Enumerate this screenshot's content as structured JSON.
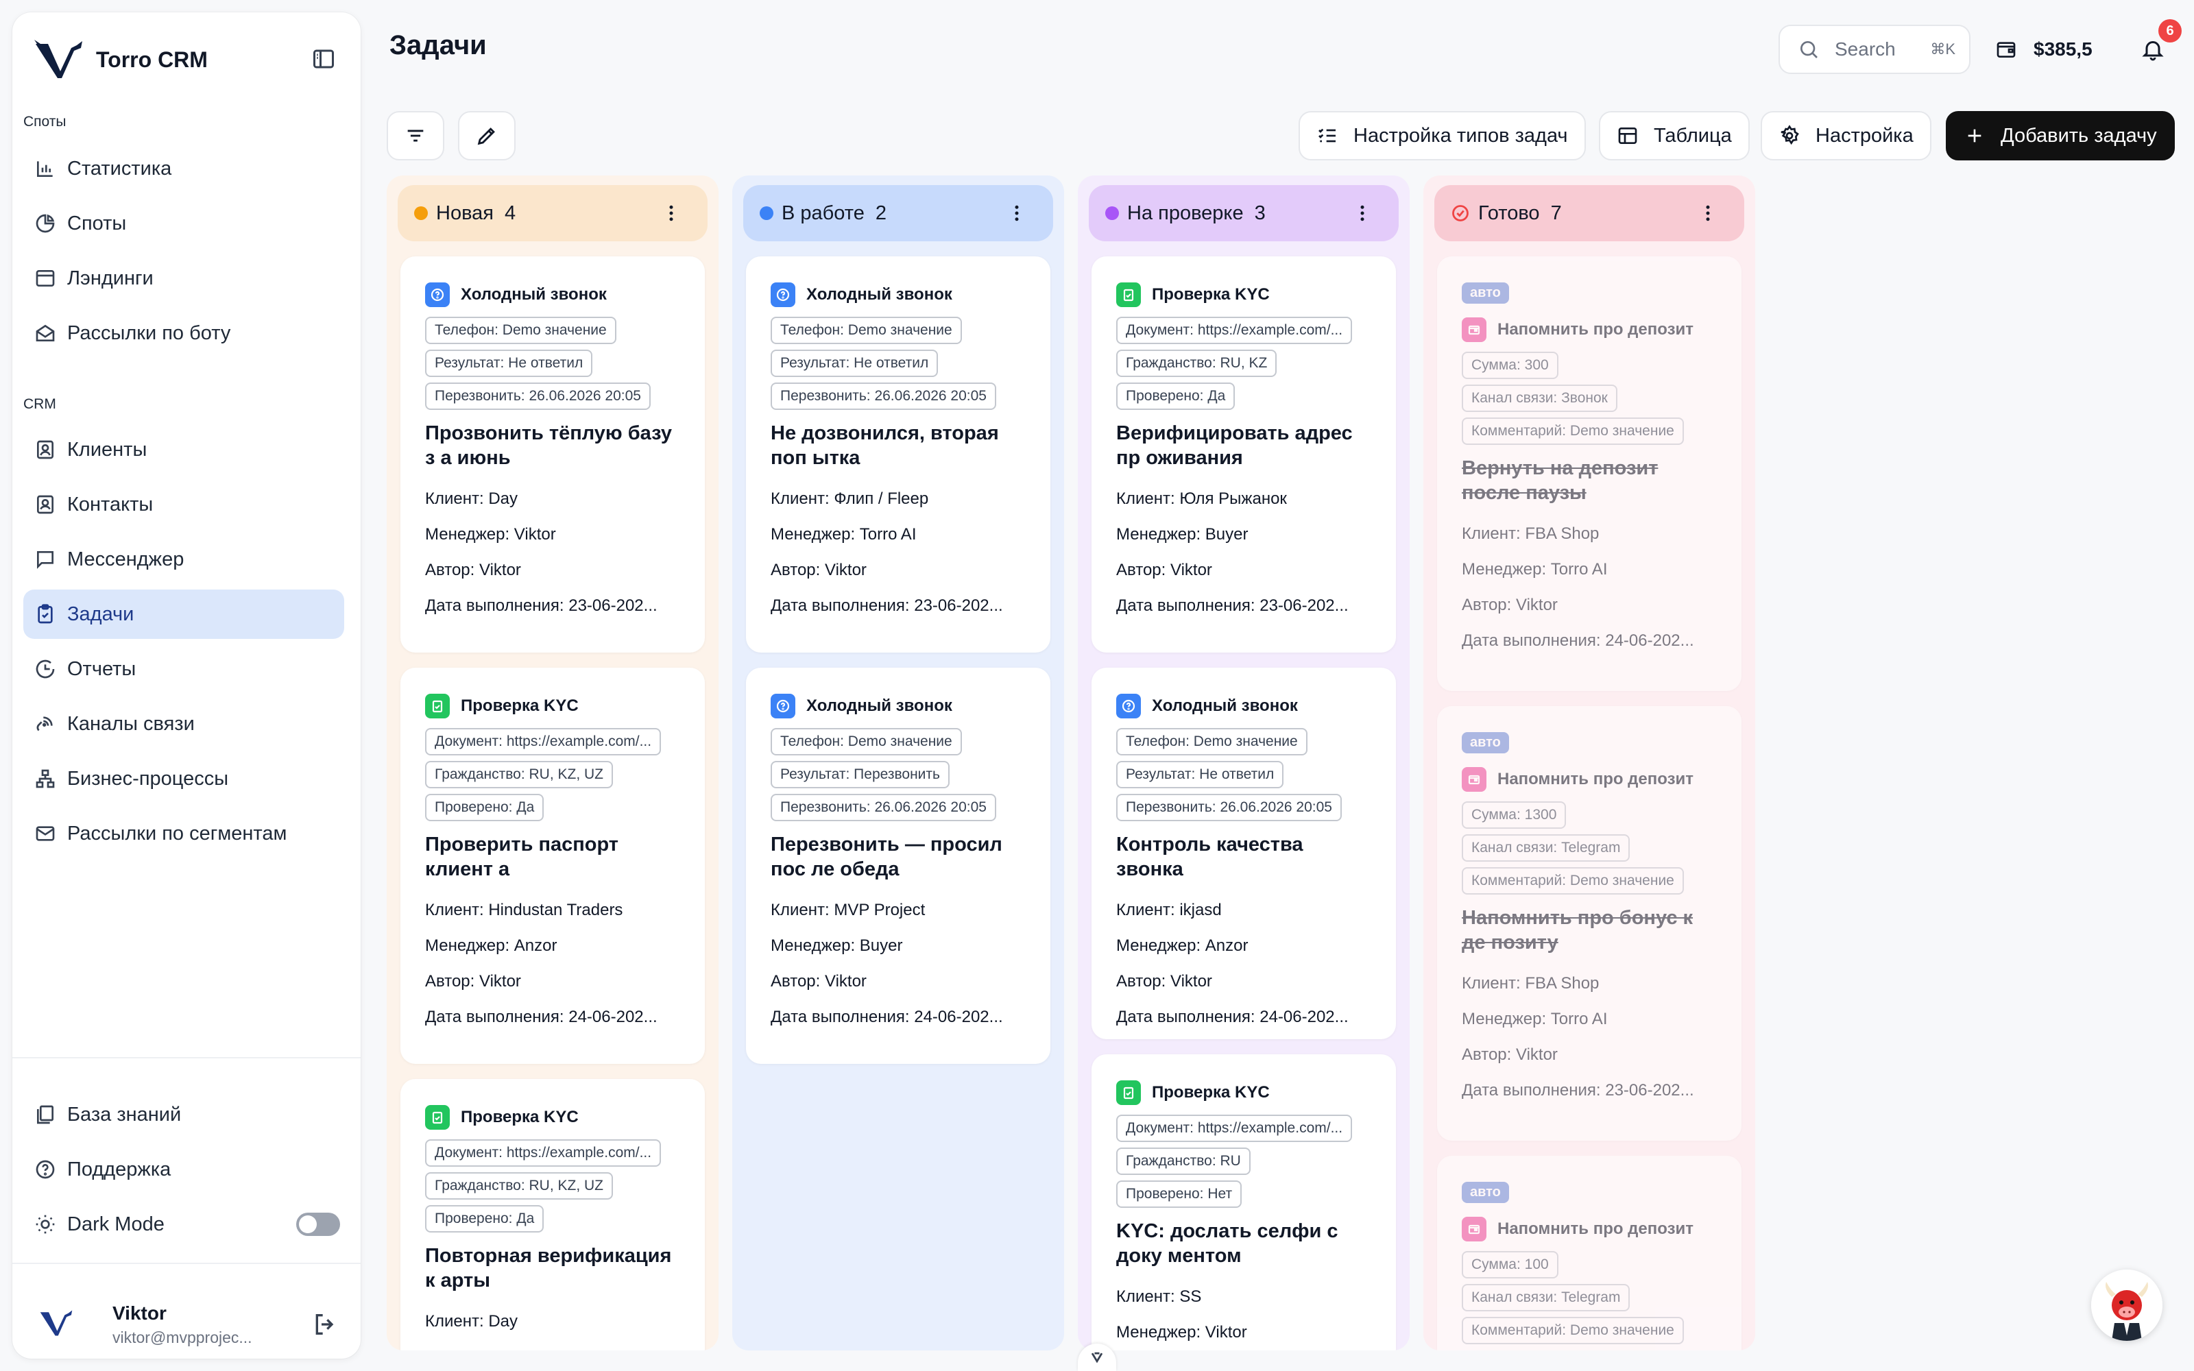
{
  "app": {
    "name": "Torro CRM"
  },
  "sidebar": {
    "section_spots": "Споты",
    "section_crm": "CRM",
    "items_spots": [
      {
        "label": "Статистика",
        "icon": "bar-chart-icon"
      },
      {
        "label": "Споты",
        "icon": "pie-chart-icon"
      },
      {
        "label": "Лэндинги",
        "icon": "window-icon"
      },
      {
        "label": "Рассылки по боту",
        "icon": "mail-open-icon"
      }
    ],
    "items_crm": [
      {
        "label": "Клиенты",
        "icon": "user-square-icon"
      },
      {
        "label": "Контакты",
        "icon": "contact-icon"
      },
      {
        "label": "Мессенджер",
        "icon": "message-icon"
      },
      {
        "label": "Задачи",
        "icon": "clipboard-check-icon",
        "active": true
      },
      {
        "label": "Отчеты",
        "icon": "clock-icon"
      },
      {
        "label": "Каналы связи",
        "icon": "link-icon"
      },
      {
        "label": "Бизнес-процессы",
        "icon": "network-icon"
      },
      {
        "label": "Рассылки по сегментам",
        "icon": "mail-icon"
      }
    ],
    "items_bottom": [
      {
        "label": "База знаний",
        "icon": "book-icon"
      },
      {
        "label": "Поддержка",
        "icon": "help-circle-icon"
      },
      {
        "label": "Dark Mode",
        "icon": "sun-icon"
      }
    ],
    "user": {
      "name": "Viktor",
      "email": "viktor@mvpprojec..."
    }
  },
  "header": {
    "title": "Задачи",
    "search_placeholder": "Search",
    "search_shortcut": "⌘K",
    "balance": "$385,5",
    "notifications": "6"
  },
  "toolbar": {
    "task_types": "Настройка типов задач",
    "table": "Таблица",
    "settings": "Настройка",
    "add_task": "Добавить задачу"
  },
  "colors": {
    "accent": "#111111",
    "col_new": "#fbe6cc",
    "col_work": "#c7dafc",
    "col_review": "#e3cbfa",
    "col_done": "#f8cbd3"
  },
  "columns": [
    {
      "title": "Новая",
      "count": "4",
      "cards": [
        {
          "type": "Холодный звонок",
          "tags": [
            "Телефон: Demo значение",
            "Результат: Не ответил",
            "Перезвонить: 26.06.2026 20:05"
          ],
          "title": "Прозвонить тёплую базу з а июнь",
          "client": "Day",
          "manager": "Viktor",
          "author": "Viktor",
          "due": "23-06-202..."
        },
        {
          "type": "Проверка KYC",
          "tags": [
            "Документ: https://example.com/...",
            "Гражданство: RU, KZ, UZ",
            "Проверено: Да"
          ],
          "title": "Проверить паспорт клиент а",
          "client": "Hindustan Traders",
          "manager": "Anzor",
          "author": "Viktor",
          "due": "24-06-202..."
        },
        {
          "type": "Проверка KYC",
          "tags": [
            "Документ: https://example.com/...",
            "Гражданство: RU, KZ, UZ",
            "Проверено: Да"
          ],
          "title": "Повторная верификация к арты",
          "client": "Day",
          "manager": "",
          "author": "",
          "due": ""
        }
      ]
    },
    {
      "title": "В работе",
      "count": "2",
      "cards": [
        {
          "type": "Холодный звонок",
          "tags": [
            "Телефон: Demo значение",
            "Результат: Не ответил",
            "Перезвонить: 26.06.2026 20:05"
          ],
          "title": "Не дозвонился, вторая поп ытка",
          "client": "Флип / Fleep",
          "manager": "Torro AI",
          "author": "Viktor",
          "due": "23-06-202..."
        },
        {
          "type": "Холодный звонок",
          "tags": [
            "Телефон: Demo значение",
            "Результат: Перезвонить",
            "Перезвонить: 26.06.2026 20:05"
          ],
          "title": "Перезвонить — просил пос ле обеда",
          "client": "MVP Project",
          "manager": "Buyer",
          "author": "Viktor",
          "due": "24-06-202..."
        }
      ]
    },
    {
      "title": "На проверке",
      "count": "3",
      "cards": [
        {
          "type": "Проверка KYC",
          "tags": [
            "Документ: https://example.com/...",
            "Гражданство: RU, KZ",
            "Проверено: Да"
          ],
          "title": "Верифицировать адрес пр оживания",
          "client": "Юля Рыжанок",
          "manager": "Buyer",
          "author": "Viktor",
          "due": "23-06-202..."
        },
        {
          "type": "Холодный звонок",
          "tags": [
            "Телефон: Demo значение",
            "Результат: Не ответил",
            "Перезвонить: 26.06.2026 20:05"
          ],
          "title": "Контроль качества звонка",
          "client": "ikjasd",
          "manager": "Anzor",
          "author": "Viktor",
          "due": "24-06-202..."
        },
        {
          "type": "Проверка KYC",
          "tags": [
            "Документ: https://example.com/...",
            "Гражданство: RU",
            "Проверено: Нет"
          ],
          "title": "KYC: дослать селфи с доку ментом",
          "client": "SS",
          "manager": "Viktor",
          "author": "",
          "due": ""
        }
      ]
    },
    {
      "title": "Готово",
      "count": "7",
      "cards": [
        {
          "badge": "авто",
          "type": "Напомнить про депозит",
          "tags": [
            "Сумма: 300",
            "Канал связи: Звонок",
            "Комментарий: Demo значение"
          ],
          "title": "Вернуть на депозит после паузы",
          "client": "FBA Shop",
          "manager": "Torro AI",
          "author": "Viktor",
          "due": "24-06-202..."
        },
        {
          "badge": "авто",
          "type": "Напомнить про депозит",
          "tags": [
            "Сумма: 1300",
            "Канал связи: Telegram",
            "Комментарий: Demo значение"
          ],
          "title": "Напомнить про бонус к де позиту",
          "client": "FBA Shop",
          "manager": "Torro AI",
          "author": "Viktor",
          "due": "23-06-202..."
        },
        {
          "badge": "авто",
          "type": "Напомнить про депозит",
          "tags": [
            "Сумма: 100",
            "Канал связи: Telegram",
            "Комментарий: Demo значение"
          ],
          "title": "",
          "client": "",
          "manager": "",
          "author": "",
          "due": ""
        }
      ]
    }
  ],
  "labels": {
    "client": "Клиент:",
    "manager": "Менеджер:",
    "author": "Автор:",
    "due": "Дата выполнения:"
  }
}
